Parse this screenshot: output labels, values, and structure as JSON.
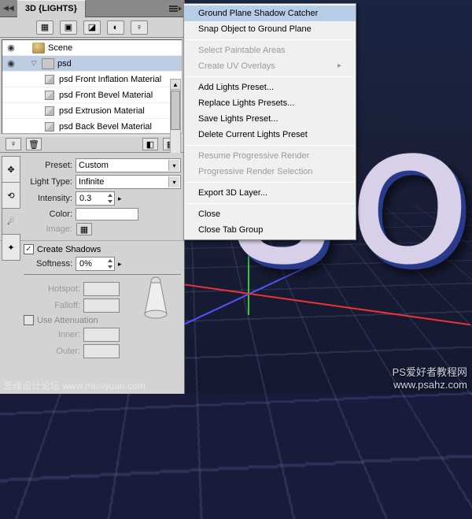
{
  "panel": {
    "tab_title": "3D {LIGHTS}",
    "scene_root": "Scene",
    "scene_group": "psd",
    "materials": [
      "psd Front Inflation Material",
      "psd Front Bevel Material",
      "psd Extrusion Material",
      "psd Back Bevel Material"
    ]
  },
  "props": {
    "preset_label": "Preset:",
    "preset_value": "Custom",
    "light_type_label": "Light Type:",
    "light_type_value": "Infinite",
    "intensity_label": "Intensity:",
    "intensity_value": "0.3",
    "color_label": "Color:",
    "image_label": "Image:",
    "create_shadows_label": "Create Shadows",
    "softness_label": "Softness:",
    "softness_value": "0%",
    "hotspot_label": "Hotspot:",
    "falloff_label": "Falloff:",
    "attenuation_label": "Use Attenuation",
    "inner_label": "Inner:",
    "outer_label": "Outer:"
  },
  "menu": {
    "items": [
      {
        "label": "Ground Plane Shadow Catcher",
        "state": "hover"
      },
      {
        "label": "Snap Object to Ground Plane",
        "state": ""
      },
      {
        "sep": true
      },
      {
        "label": "Select Paintable Areas",
        "state": "disabled"
      },
      {
        "label": "Create UV Overlays",
        "state": "disabled",
        "sub": true
      },
      {
        "sep": true
      },
      {
        "label": "Add Lights Preset...",
        "state": ""
      },
      {
        "label": "Replace Lights Presets...",
        "state": ""
      },
      {
        "label": "Save Lights Preset...",
        "state": ""
      },
      {
        "label": "Delete Current Lights Preset",
        "state": ""
      },
      {
        "sep": true
      },
      {
        "label": "Resume Progressive Render",
        "state": "disabled"
      },
      {
        "label": "Progressive Render Selection",
        "state": "disabled"
      },
      {
        "sep": true
      },
      {
        "label": "Export 3D Layer...",
        "state": ""
      },
      {
        "sep": true
      },
      {
        "label": "Close",
        "state": ""
      },
      {
        "label": "Close Tab Group",
        "state": ""
      }
    ]
  },
  "watermarks": {
    "left": "思缘设计论坛  www.missyuan.com",
    "right": "PS爱好者教程网\nwww.psahz.com"
  },
  "chart_data": null
}
